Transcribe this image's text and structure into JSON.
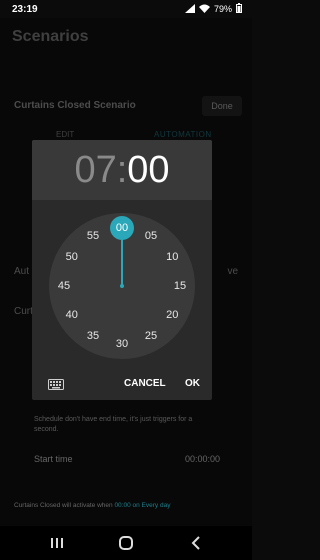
{
  "status_bar": {
    "time": "23:19",
    "battery": "79%"
  },
  "background": {
    "title": "Scenarios",
    "scenario_name": "Curtains Closed Scenario",
    "done_label": "Done",
    "tab_edit": "EDIT",
    "tab_automation": "AUTOMATION",
    "row_auto_left": "Aut",
    "row_auto_right": "ve",
    "row_curt_left": "Curt",
    "hint": "Schedule don't have end time, it's just triggers for a second.",
    "start_time_label": "Start time",
    "start_time_value": "00:00:00",
    "summary_prefix": "Curtains Closed will activate when ",
    "summary_accent": "00:00 on Every day"
  },
  "dialog": {
    "hour": "07",
    "separator": ":",
    "minute": "00",
    "clock_numbers": [
      "00",
      "05",
      "10",
      "15",
      "20",
      "25",
      "30",
      "35",
      "40",
      "45",
      "50",
      "55"
    ],
    "selected_minute": "00",
    "cancel_label": "CANCEL",
    "ok_label": "OK"
  },
  "colors": {
    "accent": "#2aa7b8",
    "dialog_bg": "#2a2a2a",
    "header_bg": "#393939"
  },
  "icons": [
    "keyboard-icon",
    "recents-icon",
    "home-icon",
    "back-icon",
    "signal-icon",
    "wifi-icon",
    "battery-icon"
  ]
}
